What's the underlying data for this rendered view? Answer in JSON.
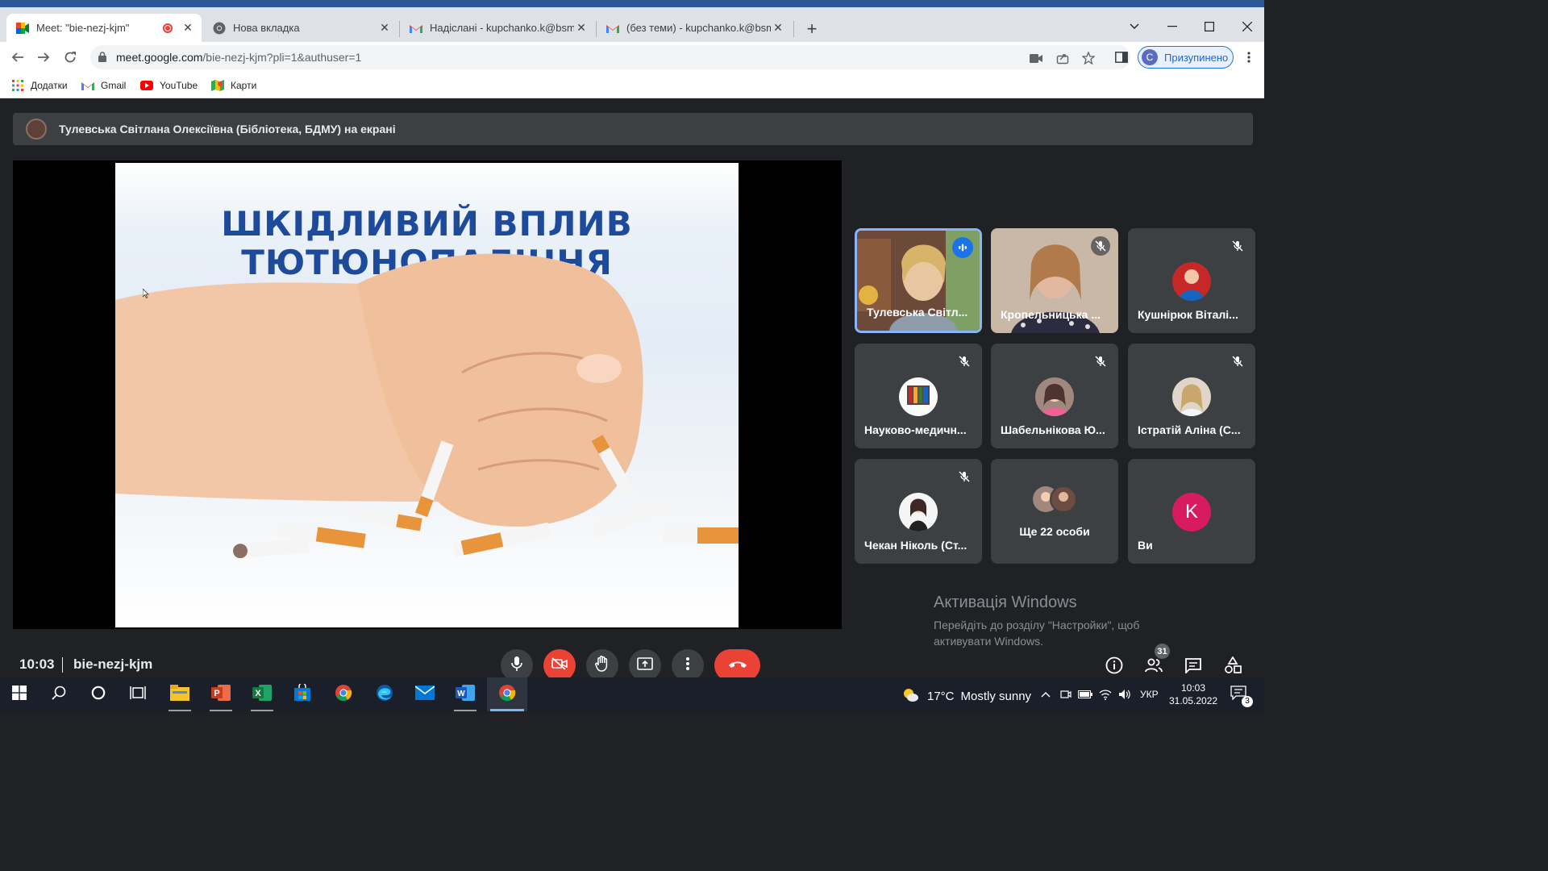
{
  "browser": {
    "tabs": [
      {
        "title": "Meet: \"bie-nezj-kjm\"",
        "recording": true
      },
      {
        "title": "Нова вкладка"
      },
      {
        "title": "Надіслані - kupchanko.k@bsmu.edu.ua"
      },
      {
        "title": "(без теми) - kupchanko.k@bsmu.edu.ua"
      }
    ],
    "url_host": "meet.google.com",
    "url_path": "/bie-nezj-kjm?pli=1&authuser=1",
    "profile_initial": "C",
    "profile_label": "Призупинено",
    "bookmarks": [
      {
        "label": "Додатки",
        "icon": "apps-grid-icon"
      },
      {
        "label": "Gmail",
        "icon": "gmail-icon"
      },
      {
        "label": "YouTube",
        "icon": "youtube-icon"
      },
      {
        "label": "Карти",
        "icon": "maps-icon"
      }
    ]
  },
  "meet": {
    "presenting_banner": "Тулевська Світлана Олексіївна (Бібліотека, БДМУ) на екрані",
    "slide": {
      "title_line1": "ШКІДЛИВИЙ ВПЛИВ",
      "title_line2": "ТЮТЮНОПАЛІННЯ"
    },
    "participants": [
      {
        "name": "Тулевська Світл...",
        "speaking": true,
        "video": true
      },
      {
        "name": "Кропельницька ...",
        "muted": true,
        "video": true
      },
      {
        "name": "Кушнірюк Віталі...",
        "muted": true
      },
      {
        "name": "Науково-медичн...",
        "muted": true
      },
      {
        "name": "Шабельнікова Ю...",
        "muted": true
      },
      {
        "name": "Істратій Аліна (С...",
        "muted": true
      },
      {
        "name": "Чекан Ніколь (Ст...",
        "muted": true
      },
      {
        "name": "Ще 22 особи"
      },
      {
        "name": "Ви",
        "initial": "K",
        "avatar_color": "#d81b60"
      }
    ],
    "clock": "10:03",
    "meeting_code": "bie-nezj-kjm",
    "people_count": "31"
  },
  "windows_activation": {
    "title": "Активація Windows",
    "subtitle": "Перейдіть до розділу \"Настройки\", щоб активувати Windows."
  },
  "taskbar": {
    "weather_temp": "17°C",
    "weather_text": "Mostly sunny",
    "language": "УКР",
    "time": "10:03",
    "date": "31.05.2022",
    "notification_count": "3"
  }
}
